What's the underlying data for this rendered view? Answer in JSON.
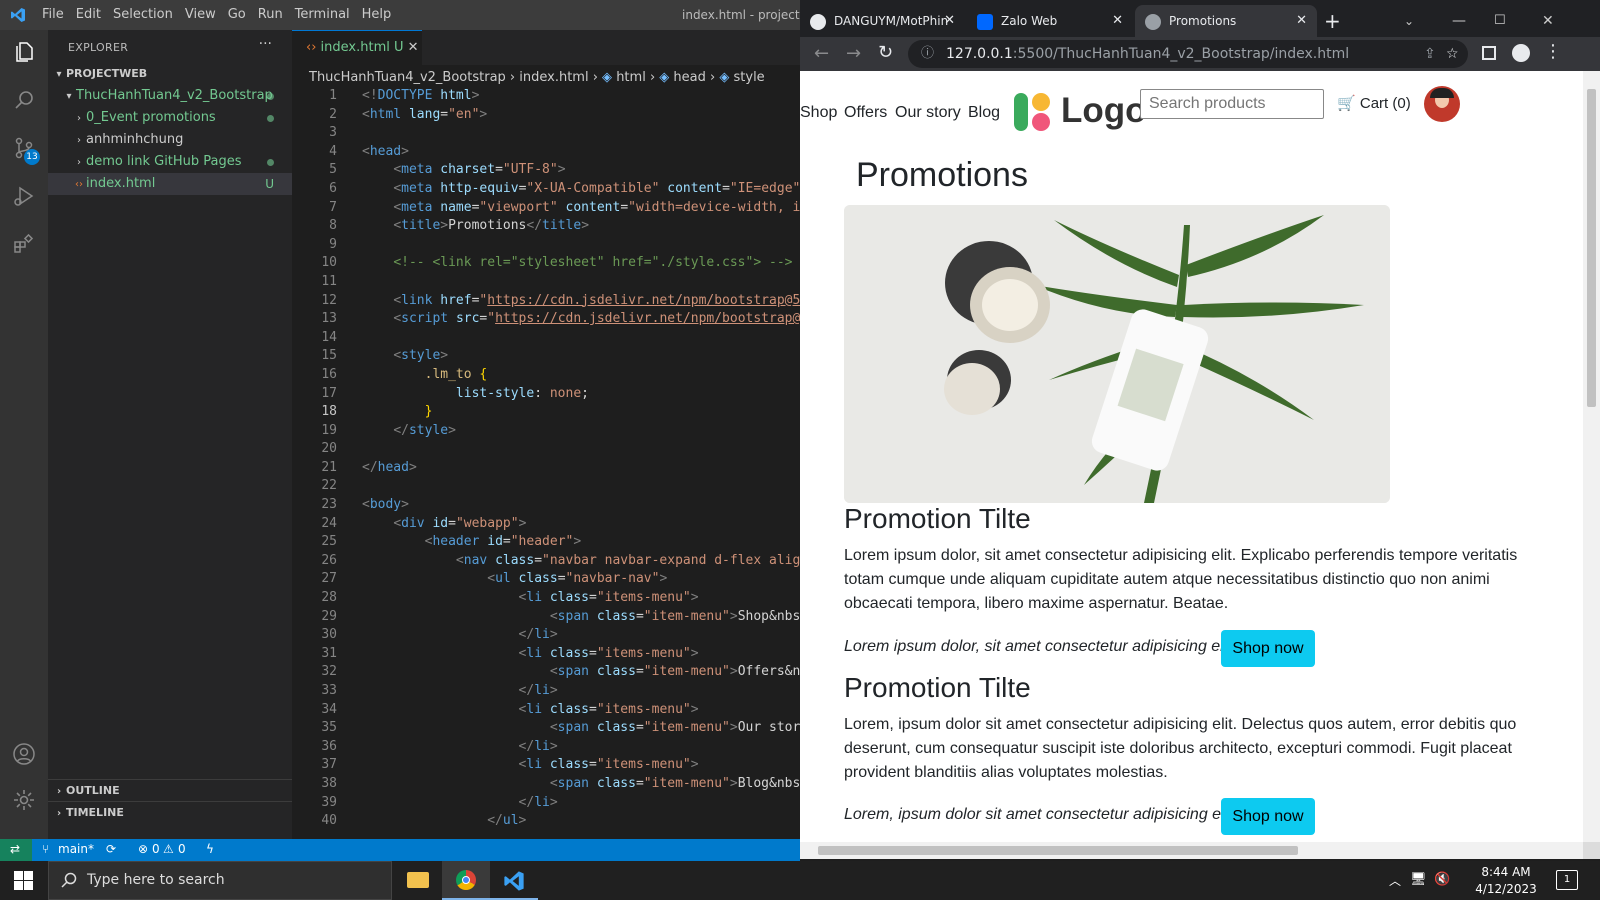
{
  "vscode": {
    "menu": [
      "File",
      "Edit",
      "Selection",
      "View",
      "Go",
      "Run",
      "Terminal",
      "Help"
    ],
    "window_title": "index.html - projectWe",
    "explorer": {
      "title": "EXPLORER",
      "project": "PROJECTWEB",
      "folder": "ThucHanhTuan4_v2_Bootstrap",
      "items": [
        "0_Event promotions",
        "anhminhchung",
        "demo link GitHub Pages"
      ],
      "file": "index.html",
      "file_status": "U",
      "outline": "OUTLINE",
      "timeline": "TIMELINE"
    },
    "scm_badge": "13",
    "tab": {
      "label": "index.html",
      "status": "U"
    },
    "breadcrumb": [
      "ThucHanhTuan4_v2_Bootstrap",
      "index.html",
      "html",
      "head",
      "style"
    ],
    "line_numbers": [
      "1",
      "2",
      "3",
      "4",
      "5",
      "6",
      "7",
      "8",
      "9",
      "10",
      "11",
      "12",
      "13",
      "14",
      "15",
      "16",
      "17",
      "18",
      "19",
      "20",
      "21",
      "22",
      "23",
      "24",
      "25",
      "26",
      "27",
      "28",
      "29",
      "30",
      "31",
      "32",
      "33",
      "34",
      "35",
      "36",
      "37",
      "38",
      "39",
      "40"
    ],
    "status": {
      "branch": "main*",
      "errors": "0",
      "warnings": "0"
    }
  },
  "chrome": {
    "tabs": [
      {
        "label": "DANGUYM/MotPhin",
        "fav_color": "#e8eaed"
      },
      {
        "label": "Zalo Web",
        "fav_color": "#0068ff"
      },
      {
        "label": "Promotions",
        "fav_color": "#9aa0a6"
      }
    ],
    "url_host": "127.0.0.1",
    "url_path": ":5500/ThucHanhTuan4_v2_Bootstrap/index.html"
  },
  "page": {
    "nav": [
      "Shop",
      "Offers",
      "Our story",
      "Blog"
    ],
    "logo": "Logo",
    "search_placeholder": "Search products",
    "cart": "Cart (0)",
    "heading": "Promotions",
    "promos": [
      {
        "title": "Promotion Tilte",
        "body": "Lorem ipsum dolor, sit amet consectetur adipisicing elit. Explicabo perferendis tempore veritatis totam cumque unde aliquam cupiditate autem atque necessitatibus distinctio quo non animi obcaecati tempora, libero maxime aspernatur. Beatae.",
        "tagline": "Lorem ipsum dolor, sit amet consectetur adipisicing elit.",
        "button": "Shop now"
      },
      {
        "title": "Promotion Tilte",
        "body": "Lorem, ipsum dolor sit amet consectetur adipisicing elit. Delectus quos autem, error debitis quo deserunt, cum consequatur suscipit iste doloribus architecto, excepturi commodi. Fugit placeat provident blanditiis alias voluptates molestias.",
        "tagline": "Lorem, ipsum dolor sit amet consectetur adipisicing elit.",
        "button": "Shop now"
      }
    ]
  },
  "taskbar": {
    "search_placeholder": "Type here to search",
    "time": "8:44 AM",
    "date": "4/12/2023",
    "notification_count": "1"
  },
  "colors": {
    "accent": "#007acc",
    "button": "#0dcaf0",
    "git_added": "#73c991"
  }
}
